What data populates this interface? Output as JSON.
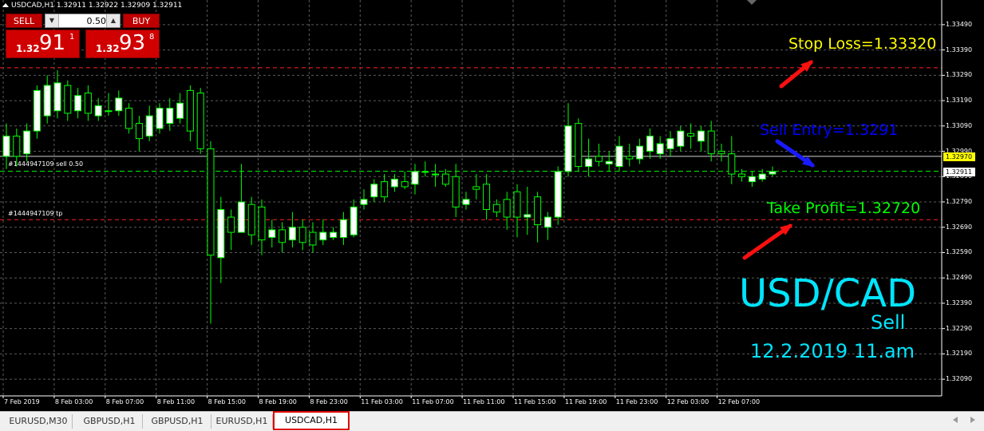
{
  "header": {
    "text": "USDCAD,H1  1.32911 1.32922 1.32909 1.32911"
  },
  "trade_panel": {
    "sell_label": "SELL",
    "buy_label": "BUY",
    "lot_value": "0.50",
    "down_icon": "▼",
    "up_icon": "▲",
    "sell_price": {
      "small": "1.32",
      "big": "91",
      "sup": "1"
    },
    "buy_price": {
      "small": "1.32",
      "big": "93",
      "sup": "8"
    }
  },
  "price_axis": {
    "labels": [
      "1.33490",
      "1.33390",
      "1.33290",
      "1.33190",
      "1.33090",
      "1.32990",
      "1.32890",
      "1.32790",
      "1.32690",
      "1.32590",
      "1.32490",
      "1.32390",
      "1.32290",
      "1.32190",
      "1.32090"
    ],
    "current_price": "1.32911",
    "highlight_price": "1.32970"
  },
  "time_axis": {
    "labels": [
      "7 Feb 2019",
      "8 Feb 03:00",
      "8 Feb 07:00",
      "8 Feb 11:00",
      "8 Feb 15:00",
      "8 Feb 19:00",
      "8 Feb 23:00",
      "11 Feb 03:00",
      "11 Feb 07:00",
      "11 Feb 11:00",
      "11 Feb 15:00",
      "11 Feb 19:00",
      "11 Feb 23:00",
      "12 Feb 03:00",
      "12 Feb 07:00"
    ]
  },
  "order_lines": {
    "sell_label": "#1444947109 sell 0.50",
    "tp_label": "#1444947109 tp"
  },
  "annotations": {
    "stop_loss": "Stop Loss=1.33320",
    "sell_entry": "Sell Entry=1.3291",
    "take_profit": "Take Profit=1.32720",
    "symbol": "USD/CAD",
    "side": "Sell",
    "date": "12.2.2019 11.am"
  },
  "tabs": [
    {
      "label": "EURUSD,M30",
      "active": false
    },
    {
      "label": "GBPUSD,H1",
      "active": false
    },
    {
      "label": "GBPUSD,H1",
      "active": false
    },
    {
      "label": "EURUSD,H1",
      "active": false
    },
    {
      "label": "USDCAD,H1",
      "active": true
    }
  ],
  "colors": {
    "background": "#000000",
    "bull_candle": "#ffffff",
    "bear_candle": "#000000",
    "candle_outline": "#00ff00",
    "grid": "#5a5a5a",
    "stop_loss": "#ffff00",
    "sell_entry": "#0000ff",
    "take_profit": "#00ff00",
    "symbol_text": "#00e5ff",
    "arrow_red": "#ff1010",
    "arrow_blue": "#1a1aff",
    "sell_button": "#c00000",
    "highlight_tag": "#ffff00"
  },
  "chart_data": {
    "type": "candlestick",
    "symbol": "USDCAD",
    "timeframe": "H1",
    "ylim": [
      1.3204,
      1.3354
    ],
    "levels": {
      "stop_loss": 1.3332,
      "sell_entry": 1.32911,
      "take_profit": 1.3272,
      "highlight": 1.3297
    },
    "candles": [
      [
        1.3297,
        1.3305,
        1.331,
        1.3292
      ],
      [
        1.3305,
        1.3297,
        1.3308,
        1.3293
      ],
      [
        1.3298,
        1.3307,
        1.331,
        1.3295
      ],
      [
        1.3307,
        1.3323,
        1.3325,
        1.3304
      ],
      [
        1.3313,
        1.3325,
        1.3329,
        1.331
      ],
      [
        1.3315,
        1.3326,
        1.3331,
        1.3312
      ],
      [
        1.3325,
        1.3314,
        1.3327,
        1.3311
      ],
      [
        1.3315,
        1.3321,
        1.3324,
        1.3312
      ],
      [
        1.3322,
        1.3314,
        1.3325,
        1.3311
      ],
      [
        1.3313,
        1.3317,
        1.332,
        1.3311
      ],
      [
        1.3315,
        1.3315,
        1.3322,
        1.3313
      ],
      [
        1.3315,
        1.332,
        1.3323,
        1.3313
      ],
      [
        1.3316,
        1.3308,
        1.3318,
        1.3306
      ],
      [
        1.331,
        1.3304,
        1.3313,
        1.3299
      ],
      [
        1.3305,
        1.3313,
        1.3317,
        1.3303
      ],
      [
        1.3308,
        1.3316,
        1.3318,
        1.3306
      ],
      [
        1.331,
        1.3316,
        1.332,
        1.3307
      ],
      [
        1.3312,
        1.3318,
        1.3322,
        1.331
      ],
      [
        1.3323,
        1.3307,
        1.3325,
        1.3303
      ],
      [
        1.3322,
        1.33,
        1.3324,
        1.3298
      ],
      [
        1.33,
        1.3258,
        1.3303,
        1.3231
      ],
      [
        1.3257,
        1.3276,
        1.3281,
        1.3247
      ],
      [
        1.3273,
        1.3267,
        1.3276,
        1.326
      ],
      [
        1.3267,
        1.3279,
        1.3294,
        1.327
      ],
      [
        1.3278,
        1.3266,
        1.3281,
        1.3262
      ],
      [
        1.3277,
        1.3264,
        1.328,
        1.3258
      ],
      [
        1.3265,
        1.3268,
        1.3272,
        1.3261
      ],
      [
        1.3268,
        1.3263,
        1.3271,
        1.3259
      ],
      [
        1.3264,
        1.3269,
        1.3275,
        1.3261
      ],
      [
        1.3269,
        1.3263,
        1.3272,
        1.326
      ],
      [
        1.3267,
        1.3262,
        1.3271,
        1.3259
      ],
      [
        1.3264,
        1.3267,
        1.3272,
        1.3262
      ],
      [
        1.3265,
        1.3267,
        1.3269,
        1.3264
      ],
      [
        1.3265,
        1.3272,
        1.3275,
        1.3262
      ],
      [
        1.3266,
        1.3277,
        1.328,
        1.3265
      ],
      [
        1.3278,
        1.328,
        1.3284,
        1.3276
      ],
      [
        1.3281,
        1.3286,
        1.3288,
        1.3279
      ],
      [
        1.3287,
        1.3281,
        1.329,
        1.3279
      ],
      [
        1.3285,
        1.3288,
        1.329,
        1.3283
      ],
      [
        1.3287,
        1.3285,
        1.3291,
        1.3284
      ],
      [
        1.3286,
        1.3291,
        1.3294,
        1.3282
      ],
      [
        1.3291,
        1.3291,
        1.3295,
        1.3289
      ],
      [
        1.329,
        1.329,
        1.3294,
        1.3285
      ],
      [
        1.329,
        1.3286,
        1.3292,
        1.3285
      ],
      [
        1.3289,
        1.3277,
        1.3294,
        1.3273
      ],
      [
        1.3278,
        1.328,
        1.3283,
        1.3276
      ],
      [
        1.3285,
        1.3284,
        1.329,
        1.328
      ],
      [
        1.3286,
        1.3276,
        1.329,
        1.3272
      ],
      [
        1.3278,
        1.3275,
        1.328,
        1.3273
      ],
      [
        1.328,
        1.3273,
        1.3283,
        1.3268
      ],
      [
        1.3283,
        1.3273,
        1.3286,
        1.3265
      ],
      [
        1.3273,
        1.3274,
        1.3285,
        1.3266
      ],
      [
        1.3281,
        1.327,
        1.3283,
        1.3263
      ],
      [
        1.3269,
        1.3273,
        1.3275,
        1.3264
      ],
      [
        1.3273,
        1.3291,
        1.3293,
        1.327
      ],
      [
        1.3291,
        1.3309,
        1.3318,
        1.3289
      ],
      [
        1.331,
        1.3293,
        1.3312,
        1.3291
      ],
      [
        1.3293,
        1.3296,
        1.3304,
        1.3289
      ],
      [
        1.3297,
        1.3295,
        1.3302,
        1.3293
      ],
      [
        1.3294,
        1.3295,
        1.3299,
        1.3291
      ],
      [
        1.3293,
        1.3301,
        1.3305,
        1.3291
      ],
      [
        1.3297,
        1.3296,
        1.3302,
        1.3293
      ],
      [
        1.3296,
        1.3301,
        1.3304,
        1.3294
      ],
      [
        1.3299,
        1.3305,
        1.3308,
        1.3296
      ],
      [
        1.3298,
        1.3302,
        1.3305,
        1.3296
      ],
      [
        1.33,
        1.3304,
        1.3307,
        1.3297
      ],
      [
        1.3301,
        1.3307,
        1.3309,
        1.3299
      ],
      [
        1.3306,
        1.3305,
        1.331,
        1.33
      ],
      [
        1.3303,
        1.3307,
        1.3309,
        1.3299
      ],
      [
        1.3307,
        1.3298,
        1.3311,
        1.3295
      ],
      [
        1.3299,
        1.3298,
        1.3302,
        1.3295
      ],
      [
        1.3298,
        1.329,
        1.3305,
        1.3286
      ],
      [
        1.329,
        1.3289,
        1.3292,
        1.3287
      ],
      [
        1.3287,
        1.3289,
        1.3291,
        1.3285
      ],
      [
        1.3288,
        1.329,
        1.3292,
        1.3287
      ],
      [
        1.329,
        1.3291,
        1.3293,
        1.3289
      ]
    ]
  }
}
